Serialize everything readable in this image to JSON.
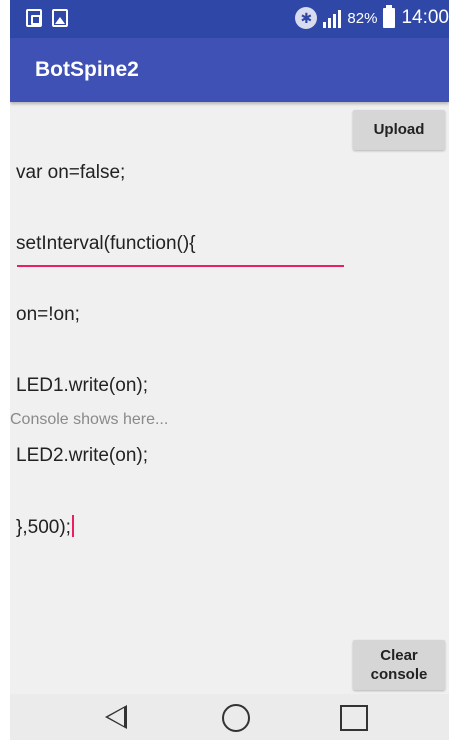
{
  "status_bar": {
    "battery_percent": "82%",
    "time": "14:00",
    "bluetooth_symbol": "✱",
    "icons": [
      "copy-icon",
      "image-icon",
      "bluetooth-icon",
      "signal-icon",
      "battery-icon"
    ]
  },
  "app_bar": {
    "title": "BotSpine2"
  },
  "editor": {
    "lines": [
      "var on=false;",
      "setInterval(function(){",
      "on=!on;",
      "LED1.write(on);",
      "LED2.write(on);",
      "},500);"
    ]
  },
  "buttons": {
    "upload": "Upload",
    "clear_console": "Clear\nconsole"
  },
  "console": {
    "placeholder": "Console shows here..."
  },
  "nav_bar": {
    "icons": [
      "back-icon",
      "home-icon",
      "recents-icon"
    ]
  },
  "colors": {
    "status_bar": "#2f47a7",
    "app_bar": "#3f51b5",
    "accent": "#e91e63",
    "background": "#f0f0f0"
  }
}
